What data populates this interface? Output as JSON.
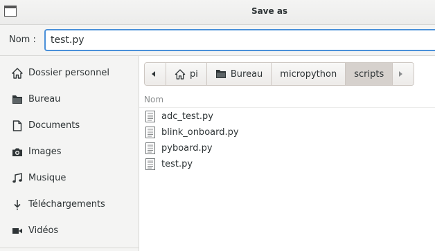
{
  "window": {
    "title": "Save as"
  },
  "name_row": {
    "label": "Nom :",
    "value": "test.py"
  },
  "sidebar": {
    "items": [
      {
        "label": "Dossier personnel",
        "icon": "home-icon"
      },
      {
        "label": "Bureau",
        "icon": "folder-icon"
      },
      {
        "label": "Documents",
        "icon": "document-icon"
      },
      {
        "label": "Images",
        "icon": "camera-icon"
      },
      {
        "label": "Musique",
        "icon": "music-icon"
      },
      {
        "label": "Téléchargements",
        "icon": "download-icon"
      },
      {
        "label": "Vidéos",
        "icon": "video-icon"
      }
    ]
  },
  "pathbar": {
    "segments": [
      {
        "label": "pi",
        "icon": "home-icon"
      },
      {
        "label": "Bureau",
        "icon": "folder-icon"
      },
      {
        "label": "micropython"
      },
      {
        "label": "scripts",
        "active": true
      }
    ]
  },
  "file_list": {
    "column_header": "Nom",
    "files": [
      {
        "name": "adc_test.py",
        "icon": "text-file-icon"
      },
      {
        "name": "blink_onboard.py",
        "icon": "text-file-icon"
      },
      {
        "name": "pyboard.py",
        "icon": "text-file-icon"
      },
      {
        "name": "test.py",
        "icon": "text-file-icon"
      }
    ]
  },
  "colors": {
    "accent": "#4a90d9",
    "active_segment": "#d6d1cd"
  }
}
